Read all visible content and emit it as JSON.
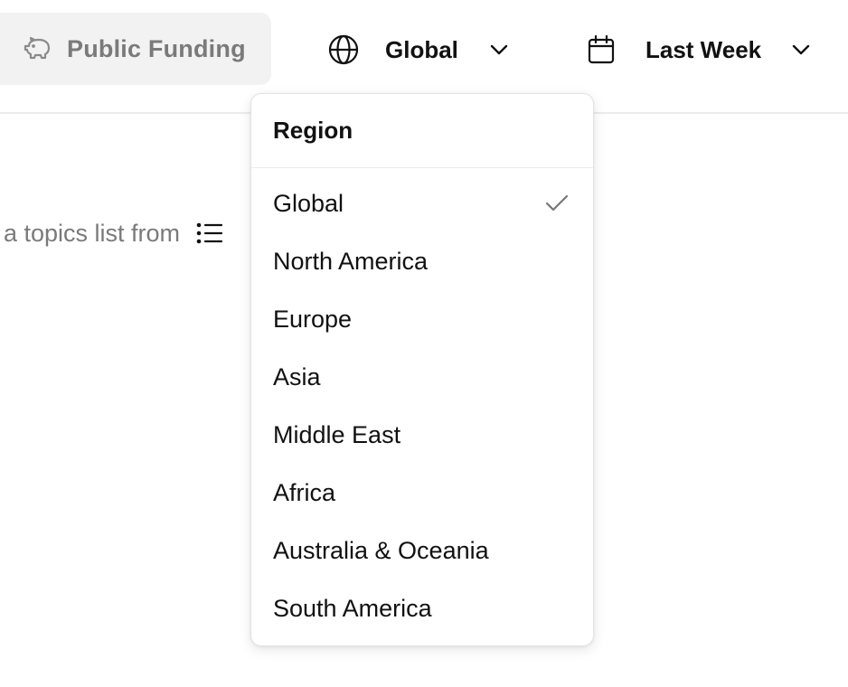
{
  "toolbar": {
    "funding_tab_label": "Public Funding",
    "funding_icon": "piggy-bank-icon",
    "region_icon": "globe-icon",
    "region_value": "Global",
    "date_icon": "calendar-icon",
    "date_value": "Last Week"
  },
  "content": {
    "hint_text": "a topics list from",
    "hint_icon": "list-icon"
  },
  "region_dropdown": {
    "title": "Region",
    "selected": "Global",
    "options": [
      "Global",
      "North America",
      "Europe",
      "Asia",
      "Middle East",
      "Africa",
      "Australia & Oceania",
      "South America"
    ]
  },
  "colors": {
    "text_primary": "#111111",
    "text_muted": "#7a7a7a",
    "tab_background": "#f2f2f2",
    "divider": "#ececec"
  }
}
